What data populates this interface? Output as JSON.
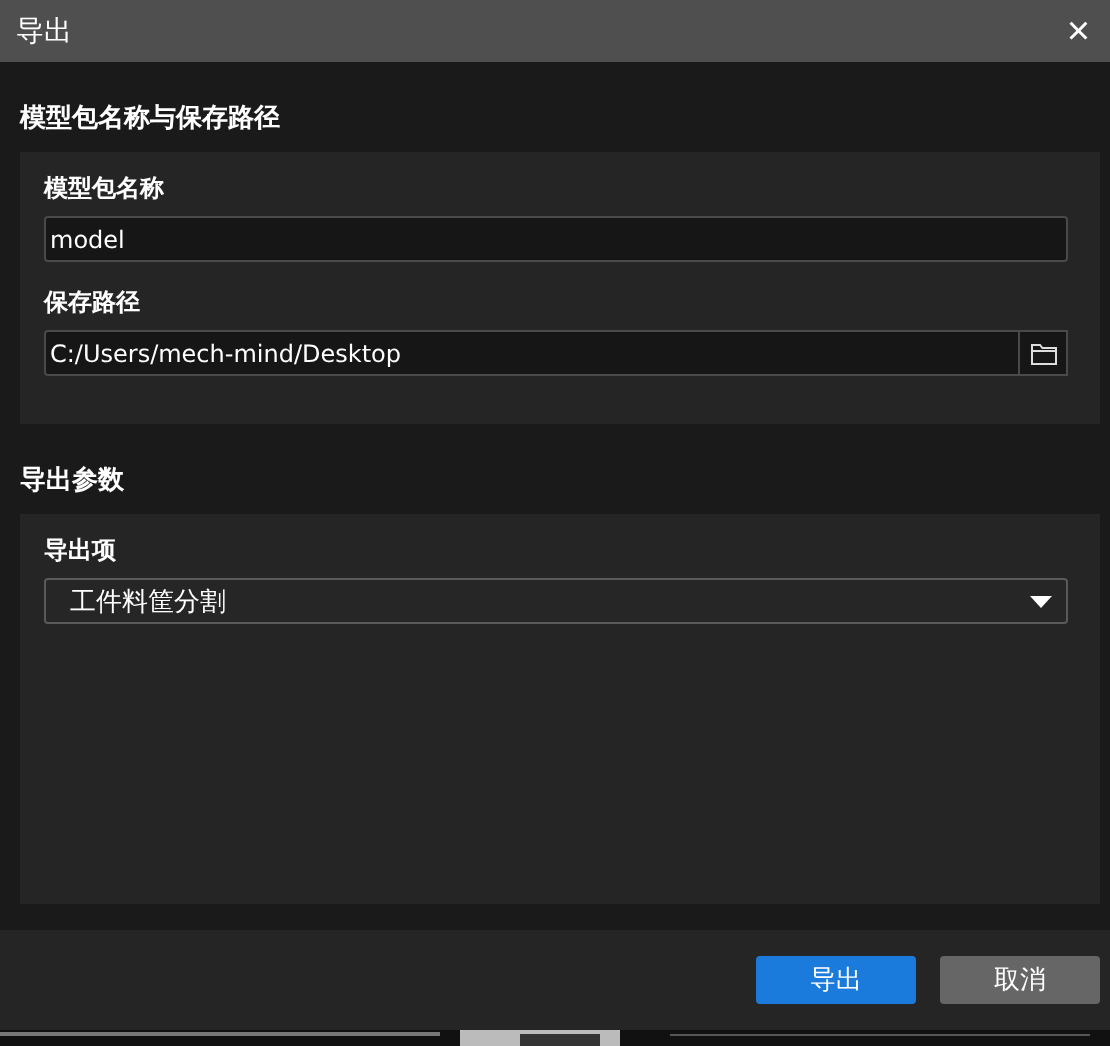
{
  "window": {
    "title": "导出",
    "close": "×"
  },
  "sections": [
    {
      "title": "模型包名称与保存路径",
      "fields": [
        {
          "kind": "text",
          "label": "模型包名称",
          "value": "model"
        },
        {
          "kind": "path",
          "label": "保存路径",
          "value": "C:/Users/mech-mind/Desktop"
        }
      ]
    },
    {
      "title": "导出参数",
      "fields": [
        {
          "kind": "select",
          "label": "导出项",
          "value": "工件料筐分割"
        }
      ]
    }
  ],
  "buttons": [
    {
      "label": "导出",
      "kind": "primary"
    },
    {
      "label": "取消",
      "kind": "secondary"
    }
  ]
}
